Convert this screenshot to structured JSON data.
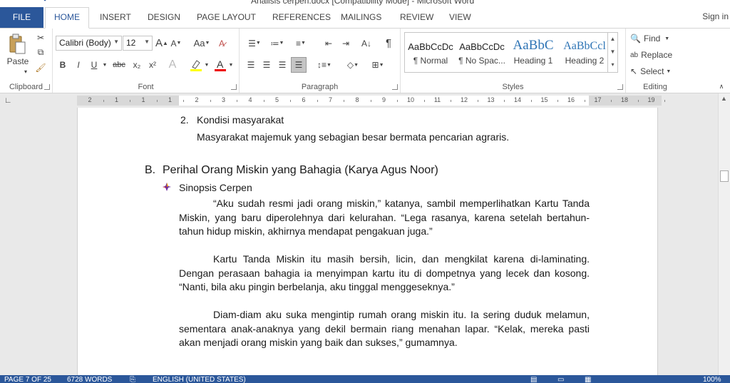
{
  "window": {
    "title": "Analisis cerpen.docx [Compatibility Mode] - Microsoft Word"
  },
  "tabs": {
    "file": "FILE",
    "items": [
      "HOME",
      "INSERT",
      "DESIGN",
      "PAGE LAYOUT",
      "REFERENCES",
      "MAILINGS",
      "REVIEW",
      "VIEW"
    ],
    "sign_in": "Sign in"
  },
  "ribbon": {
    "clipboard": {
      "label": "Clipboard",
      "paste": "Paste"
    },
    "font": {
      "label": "Font",
      "family": "Calibri (Body)",
      "size": "12",
      "bold": "B",
      "italic": "I",
      "underline": "U",
      "strike": "abc",
      "subscript": "x₂",
      "superscript": "x²",
      "change_case": "Aa",
      "grow": "A",
      "shrink": "A"
    },
    "paragraph": {
      "label": "Paragraph",
      "pilcrow": "¶"
    },
    "styles": {
      "label": "Styles",
      "items": [
        {
          "sample": "AaBbCcDc",
          "name": "¶ Normal"
        },
        {
          "sample": "AaBbCcDc",
          "name": "¶ No Spac..."
        },
        {
          "sample": "AaBbC",
          "name": "Heading 1"
        },
        {
          "sample": "AaBbCcl",
          "name": "Heading 2"
        }
      ]
    },
    "editing": {
      "label": "Editing",
      "find": "Find",
      "replace": "Replace",
      "select": "Select"
    }
  },
  "ruler": {
    "numbers": [
      "2",
      "1",
      "1",
      "1",
      "2",
      "3",
      "4",
      "5",
      "6",
      "7",
      "8",
      "9",
      "10",
      "11",
      "12",
      "13",
      "14",
      "15",
      "16",
      "17",
      "18",
      "19"
    ]
  },
  "document": {
    "item2_number": "2.",
    "item2_title": "Kondisi masyarakat",
    "item2_body": "Masyarakat majemuk yang sebagian besar bermata pencarian agraris.",
    "section_letter": "B.",
    "section_title": "Perihal Orang Miskin yang Bahagia (Karya Agus Noor)",
    "sub_heading": "Sinopsis Cerpen",
    "paragraphs": [
      "“Aku sudah resmi jadi orang miskin,” katanya, sambil memperlihatkan Kartu Tanda Miskin, yang baru diperolehnya dari kelurahan. “Lega rasanya, karena setelah bertahun-tahun hidup miskin, akhirnya mendapat pengakuan juga.”",
      "Kartu Tanda Miskin itu masih bersih, licin, dan mengkilat karena di-laminating. Dengan perasaan bahagia ia menyimpan kartu itu di dompetnya yang lecek dan kosong. “Nanti, bila aku pingin berbelanja, aku tinggal menggeseknya.”",
      "Diam-diam aku suka mengintip rumah orang miskin itu. Ia sering duduk melamun, sementara anak-anaknya yang dekil bermain riang menahan lapar. “Kelak, mereka pasti akan menjadi orang miskin yang baik dan sukses,” gumamnya."
    ]
  },
  "status": {
    "page": "PAGE 7 OF 25",
    "words": "6728 WORDS",
    "language": "ENGLISH (UNITED STATES)",
    "zoom": "100%"
  }
}
